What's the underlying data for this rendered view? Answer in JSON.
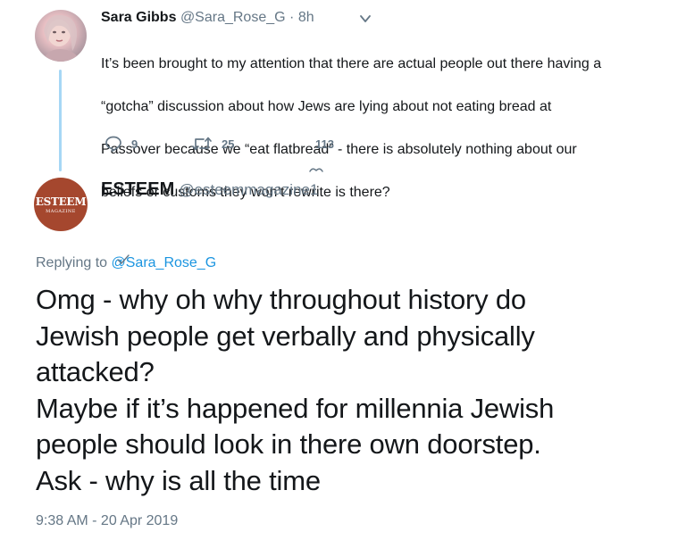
{
  "parent_tweet": {
    "author_name": "Sara Gibbs",
    "author_handle": "@Sara_Rose_G",
    "separator": "·",
    "time": "8h",
    "body_lines": [
      "It’s been brought to my attention that there are actual people out there having a",
      "“gotcha” discussion about how Jews are lying about not eating bread at",
      "Passover because we “eat flatbread” - there is absolutely nothing about our",
      "beliefs or customs they won’t rewrite is there?"
    ],
    "actions": {
      "reply_count": "9",
      "retweet_count": "25",
      "like_count": "113"
    }
  },
  "reply_tweet": {
    "avatar_logo": {
      "main": "ESTEEM",
      "sub": "MAGAZINE"
    },
    "author_name": "ESTEEM",
    "author_handle": "@esteemmagazine1",
    "replying_prefix": "Replying to",
    "replying_mention": "@Sara_Rose_G",
    "body_lines": [
      "Omg - why oh why throughout history do",
      "Jewish people get verbally and physically",
      "attacked?",
      "Maybe if it’s happened for millennia Jewish",
      "people should look in there own doorstep.",
      "Ask - why is all the time"
    ],
    "timestamp": "9:38 AM - 20 Apr 2019"
  },
  "colors": {
    "text_primary": "#14171a",
    "text_secondary": "#657786",
    "link": "#1b95e0",
    "thread_line": "#a6d7f5",
    "esteem_brand": "#a5472e"
  },
  "icons": {
    "reply": "reply-icon",
    "retweet": "retweet-icon",
    "like": "heart-icon",
    "menu": "chevron-down-icon"
  }
}
